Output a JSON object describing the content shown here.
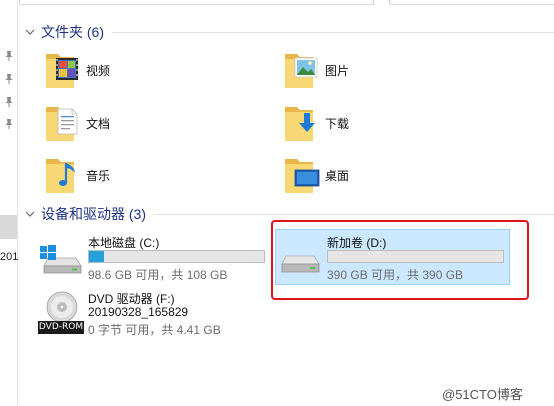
{
  "folders_section": {
    "title": "文件夹 (6)",
    "items": [
      {
        "label": "视频",
        "icon": "videos-folder-icon"
      },
      {
        "label": "图片",
        "icon": "pictures-folder-icon"
      },
      {
        "label": "文档",
        "icon": "documents-folder-icon"
      },
      {
        "label": "下载",
        "icon": "downloads-folder-icon"
      },
      {
        "label": "音乐",
        "icon": "music-folder-icon"
      },
      {
        "label": "桌面",
        "icon": "desktop-folder-icon"
      }
    ]
  },
  "devices_section": {
    "title": "设备和驱动器 (3)",
    "drives": [
      {
        "name": "本地磁盘 (C:)",
        "info": "98.6 GB 可用，共 108 GB",
        "used_fraction": 0.087,
        "icon": "windows-drive-icon"
      },
      {
        "name": "新加卷 (D:)",
        "info": "390 GB 可用，共 390 GB",
        "used_fraction": 0.0,
        "icon": "hard-drive-icon",
        "selected": true
      },
      {
        "name": "DVD 驱动器 (F:)",
        "label_line": "20190328_165829",
        "info": "0 字节 可用，共 4.41 GB",
        "badge": "DVD-ROM",
        "icon": "dvd-disc-icon"
      }
    ]
  },
  "nav": {
    "fragment": "201"
  },
  "watermark": "@51CTO博客",
  "colors": {
    "accent": "#26a0da",
    "section_title": "#1e3287",
    "selection": "#cce8ff",
    "highlight_box": "#e0141e"
  }
}
